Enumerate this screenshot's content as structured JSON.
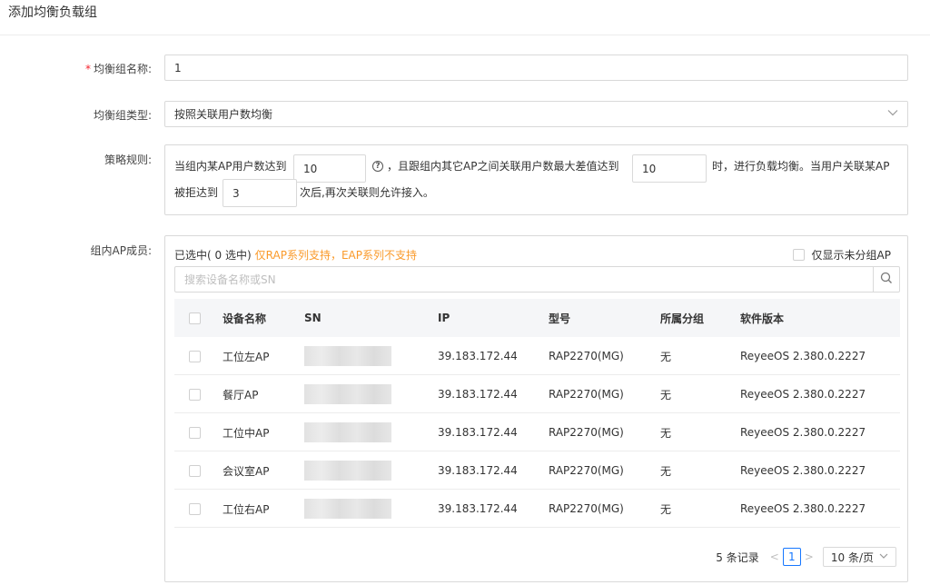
{
  "page": {
    "title": "添加均衡负载组"
  },
  "form": {
    "name": {
      "required_mark": "*",
      "label": "均衡组名称:",
      "value": "1"
    },
    "type": {
      "label": "均衡组类型:",
      "value": "按照关联用户数均衡"
    },
    "rules": {
      "label": "策略规则:",
      "text1": "当组内某AP用户数达到",
      "value1": "10",
      "text2": "，且跟组内其它AP之间关联用户数最大差值达到",
      "value2": "10",
      "text3": "时，进行负载均衡。当用户关联某AP",
      "text4": "被拒达到",
      "value3": "3",
      "text5": "次后,再次关联则允许接入。"
    },
    "members": {
      "label": "组内AP成员:"
    }
  },
  "members": {
    "selected_text": "已选中( 0 选中)",
    "warning": "仅RAP系列支持，EAP系列不支持",
    "only_ungrouped_label": "仅显示未分组AP",
    "search_placeholder": "搜索设备名称或SN",
    "columns": [
      "设备名称",
      "SN",
      "IP",
      "型号",
      "所属分组",
      "软件版本"
    ],
    "rows": [
      {
        "name": "工位左AP",
        "ip": "39.183.172.44",
        "model": "RAP2270(MG)",
        "group": "无",
        "version": "ReyeeOS 2.380.0.2227"
      },
      {
        "name": "餐厅AP",
        "ip": "39.183.172.44",
        "model": "RAP2270(MG)",
        "group": "无",
        "version": "ReyeeOS 2.380.0.2227"
      },
      {
        "name": "工位中AP",
        "ip": "39.183.172.44",
        "model": "RAP2270(MG)",
        "group": "无",
        "version": "ReyeeOS 2.380.0.2227"
      },
      {
        "name": "会议室AP",
        "ip": "39.183.172.44",
        "model": "RAP2270(MG)",
        "group": "无",
        "version": "ReyeeOS 2.380.0.2227"
      },
      {
        "name": "工位右AP",
        "ip": "39.183.172.44",
        "model": "RAP2270(MG)",
        "group": "无",
        "version": "ReyeeOS 2.380.0.2227"
      }
    ]
  },
  "pagination": {
    "total_text": "5 条记录",
    "current_page": "1",
    "page_size": "10 条/页"
  },
  "icons": {
    "help": "question-circle-icon",
    "search": "search-icon",
    "select_arrow": "chevron-down-icon"
  },
  "colors": {
    "required": "#f5222d",
    "warning": "#fa9a2a",
    "primary": "#1677ff"
  }
}
